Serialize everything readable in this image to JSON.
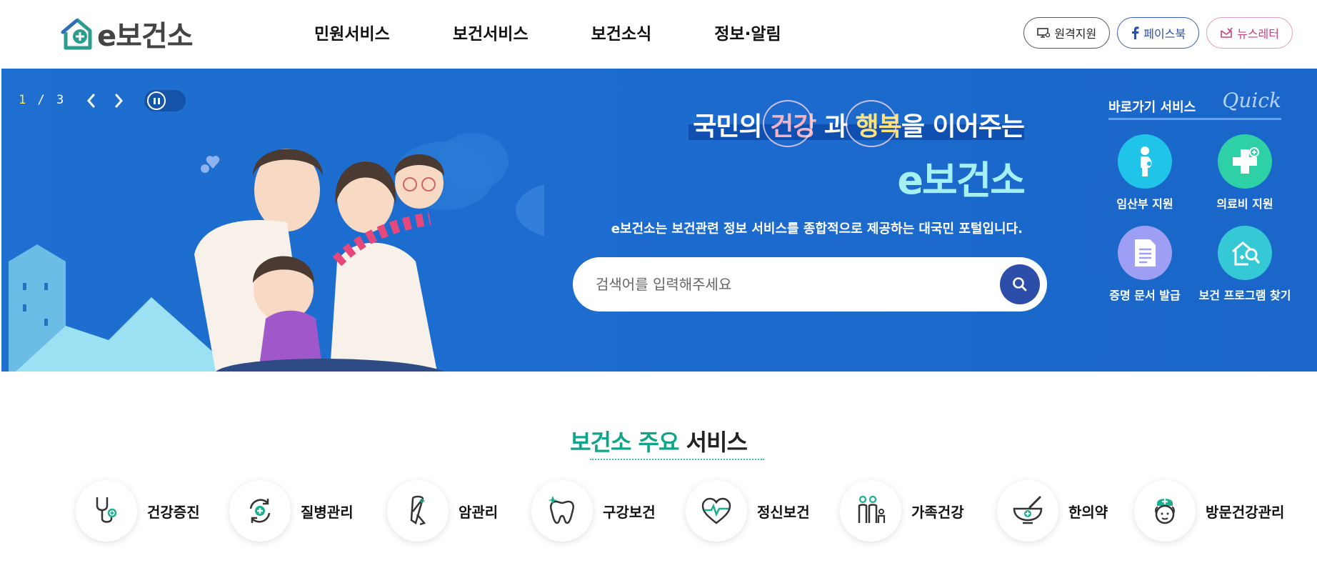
{
  "header": {
    "logo_text": "e보건소",
    "nav": [
      "민원서비스",
      "보건서비스",
      "보건소식",
      "정보·알림"
    ],
    "util": {
      "remote": "원격지원",
      "facebook": "페이스북",
      "newsletter": "뉴스레터"
    }
  },
  "hero": {
    "pager": {
      "current": "1",
      "separator": "/",
      "total": "3"
    },
    "title": {
      "part1": "국민의 ",
      "highlight1": "건강",
      "part2": " 과 ",
      "highlight2": "행복",
      "part3": "을 이어주는"
    },
    "brand": "e보건소",
    "description": "e보건소는 보건관련 정보 서비스를 종합적으로 제공하는 대국민 포털입니다.",
    "search": {
      "placeholder": "검색어를 입력해주세요",
      "value": ""
    },
    "quick": {
      "title": "바로가기 서비스",
      "script": "Quick",
      "items": [
        {
          "label": "임산부 지원",
          "icon": "pregnant-woman-icon",
          "color": "#1fc4e8"
        },
        {
          "label": "의료비 지원",
          "icon": "medical-cross-icon",
          "color": "#2ed1a6"
        },
        {
          "label": "증명 문서 발급",
          "icon": "document-icon",
          "color": "#9e9ef5"
        },
        {
          "label": "보건 프로그램 찾기",
          "icon": "home-search-icon",
          "color": "#35c9d6"
        }
      ]
    }
  },
  "services": {
    "title_green": "보건소 주요",
    "title_dark": " 서비스",
    "items": [
      {
        "label": "건강증진",
        "icon": "stethoscope-icon"
      },
      {
        "label": "질병관리",
        "icon": "disease-cycle-icon"
      },
      {
        "label": "암관리",
        "icon": "ribbon-icon"
      },
      {
        "label": "구강보건",
        "icon": "tooth-icon"
      },
      {
        "label": "정신보건",
        "icon": "heartbeat-icon"
      },
      {
        "label": "가족건강",
        "icon": "family-icon"
      },
      {
        "label": "한의약",
        "icon": "mortar-pestle-icon"
      },
      {
        "label": "방문건강관리",
        "icon": "nurse-icon"
      }
    ]
  },
  "colors": {
    "hero_bg": "#1d6ccf",
    "accent_green": "#10a58a",
    "search_btn": "#2d4ea8"
  }
}
